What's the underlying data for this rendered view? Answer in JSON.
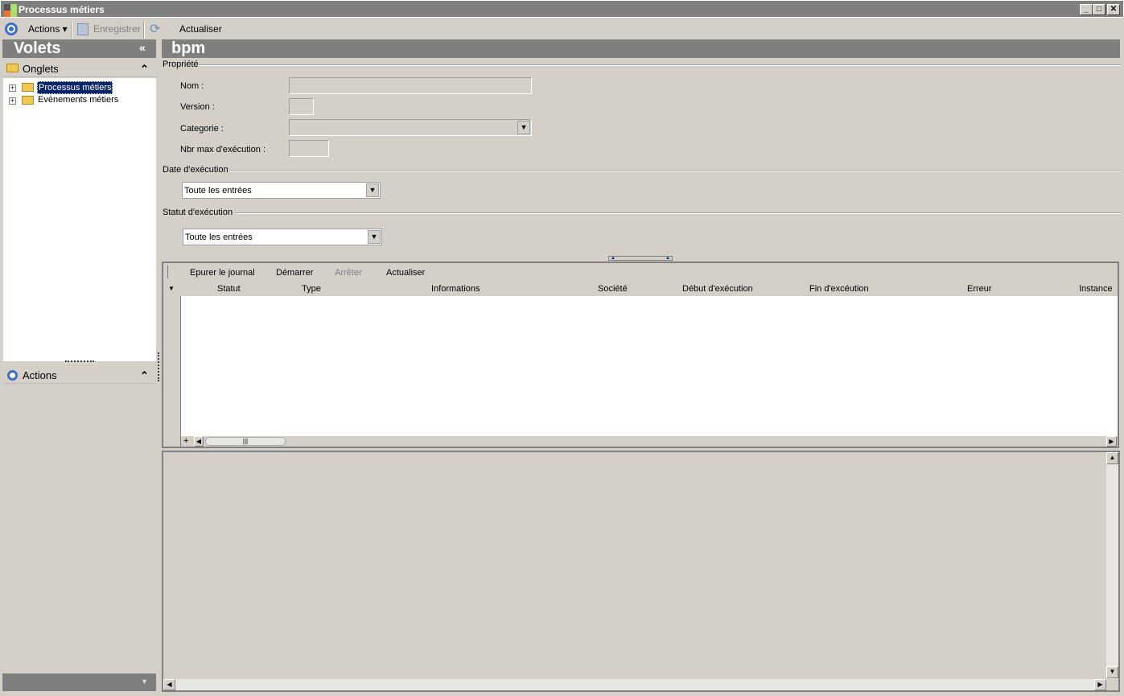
{
  "window": {
    "title": "Processus métiers",
    "minimize": "_",
    "maximize": "□",
    "close": "✕"
  },
  "toolbar": {
    "actions": "Actions ▾",
    "save": "Enregistrer",
    "refresh": "Actualiser"
  },
  "left": {
    "title": "Volets",
    "collapse": "«",
    "tabs_header": "Onglets",
    "tree": [
      {
        "label": "Processus métiers",
        "selected": true
      },
      {
        "label": "Evènements métiers",
        "selected": false
      }
    ],
    "actions_header": "Actions",
    "chev": "⌃"
  },
  "main": {
    "title": "bpm",
    "property_group": "Propriété",
    "fields": {
      "name": "Nom :",
      "version": "Version :",
      "category": "Categorie :",
      "max": "Nbr max d'exécution :"
    },
    "date_group": "Date d'exécution",
    "date_value": "Toute les entrées",
    "status_group": "Statut d'exécution",
    "status_value": "Toute les entrées"
  },
  "grid": {
    "toolbar": [
      "Epurer le journal",
      "Démarrer",
      "Arrêter",
      "Actualiser"
    ],
    "columns": [
      "Statut",
      "Type",
      "Informations",
      "Société",
      "Début d'exécution",
      "Fin d'excéution",
      "Erreur",
      "Instance"
    ]
  }
}
